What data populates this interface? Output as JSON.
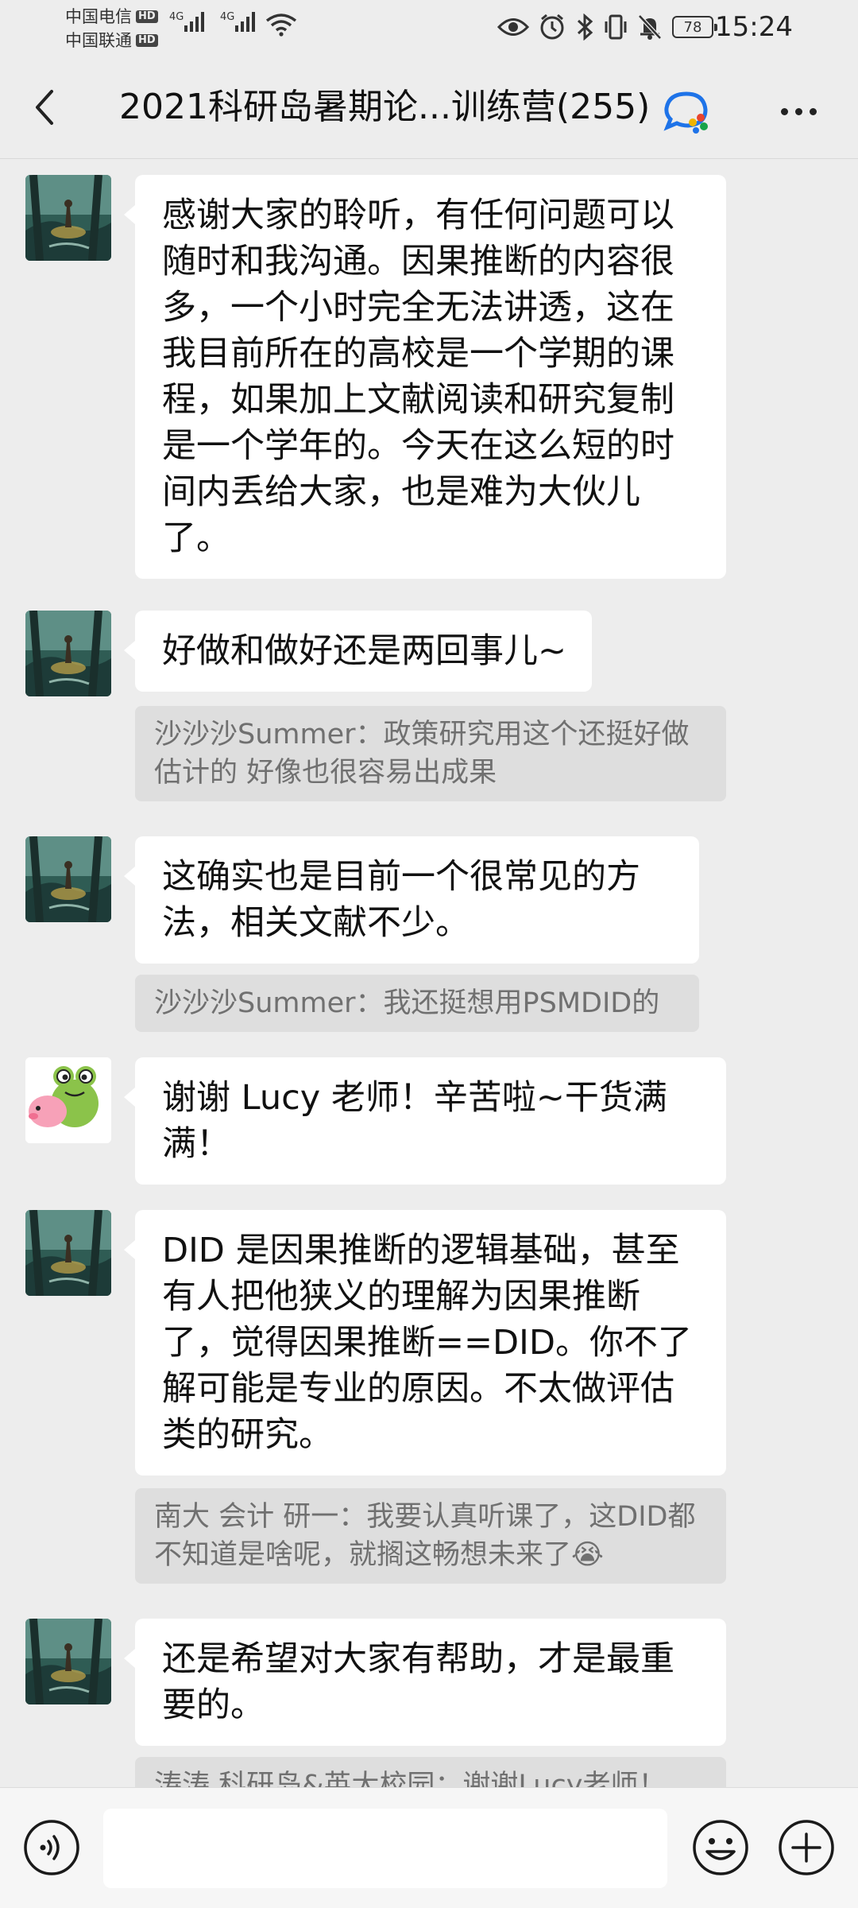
{
  "status_bar": {
    "carrier_1": "中国电信",
    "carrier_2": "中国联通",
    "hd_1": "HD",
    "hd_2": "HD",
    "network_1": "4G",
    "network_2": "4G",
    "battery": "78",
    "time": "15:24",
    "icons": [
      "eye-icon",
      "alarm-icon",
      "bluetooth-icon",
      "vibrate-icon",
      "mute-icon",
      "battery-icon"
    ]
  },
  "header": {
    "title": "2021科研岛暑期论...训练营(255)",
    "back_icon": "chevron-left-icon",
    "badge_icon": "chat-bubble-icon",
    "more_icon": "more-dots-icon"
  },
  "messages": [
    {
      "sender_avatar": "forest-avatar",
      "text": "感谢大家的聆听，有任何问题可以随时和我沟通。因果推断的内容很多，一个小时完全无法讲透，这在我目前所在的高校是一个学期的课程，如果加上文献阅读和研究复制是一个学年的。今天在这么短的时间内丢给大家，也是难为大伙儿了。"
    },
    {
      "sender_avatar": "forest-avatar",
      "text": "好做和做好还是两回事儿~",
      "quote": "沙沙沙Summer：政策研究用这个还挺好做估计的 好像也很容易出成果"
    },
    {
      "sender_avatar": "forest-avatar",
      "text": "这确实也是目前一个很常见的方法，相关文献不少。",
      "quote": "沙沙沙Summer：我还挺想用PSMDID的"
    },
    {
      "sender_avatar": "frog-avatar",
      "text": "谢谢 Lucy 老师！辛苦啦~干货满满！"
    },
    {
      "sender_avatar": "forest-avatar",
      "text": "DID 是因果推断的逻辑基础，甚至有人把他狭义的理解为因果推断了，觉得因果推断==DID。你不了解可能是专业的原因。不太做评估类的研究。",
      "quote": "南大 会计 研一：我要认真听课了，这DID都不知道是啥呢，就搁这畅想未来了😭"
    },
    {
      "sender_avatar": "forest-avatar",
      "text": "还是希望对大家有帮助，才是最重要的。",
      "quote": "涛涛 科研岛&英大校园：谢谢Lucy老师！"
    }
  ],
  "input_bar": {
    "voice_icon": "voice-icon",
    "emoji_icon": "emoji-icon",
    "plus_icon": "plus-icon",
    "input_value": ""
  },
  "colors": {
    "background": "#ededed",
    "bubble": "#ffffff",
    "quote_bg": "#dedede",
    "quote_text": "#707070"
  }
}
